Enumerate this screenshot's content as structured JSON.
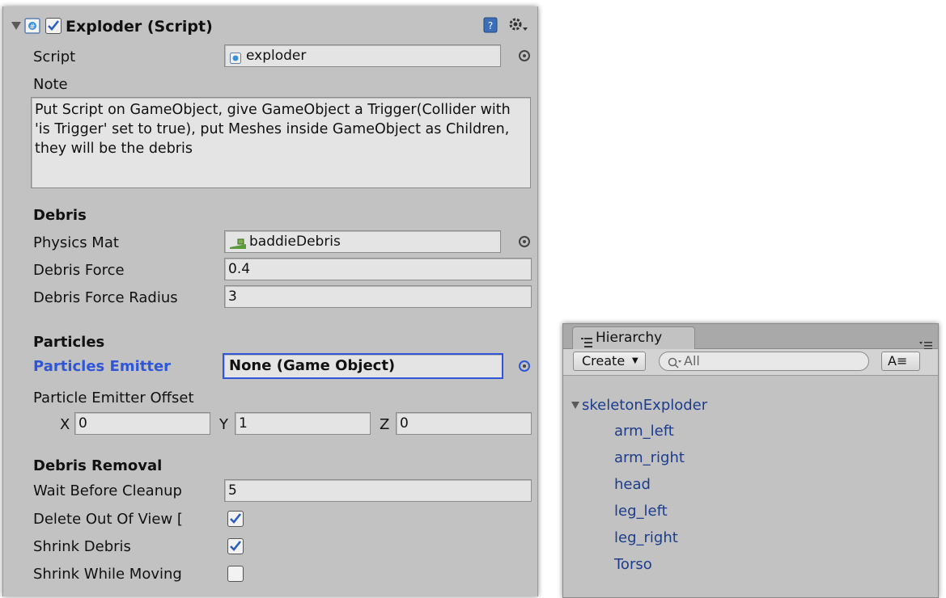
{
  "inspector": {
    "component_title": "Exploder (Script)",
    "component_enabled": true,
    "script_label": "Script",
    "script_value": "exploder",
    "note_label": "Note",
    "note_text": "Put Script on GameObject, give GameObject a Trigger(Collider with 'is Trigger' set to true), put Meshes inside GameObject as Children, they will be the debris",
    "debris_header": "Debris",
    "physics_mat_label": "Physics Mat",
    "physics_mat_value": "baddieDebris",
    "debris_force_label": "Debris Force",
    "debris_force_value": "0.4",
    "debris_force_radius_label": "Debris Force Radius",
    "debris_force_radius_value": "3",
    "particles_header": "Particles",
    "particles_emitter_label": "Particles Emitter",
    "particles_emitter_value": "None (Game Object)",
    "particle_offset_label": "Particle Emitter Offset",
    "offset_x_label": "X",
    "offset_x_value": "0",
    "offset_y_label": "Y",
    "offset_y_value": "1",
    "offset_z_label": "Z",
    "offset_z_value": "0",
    "debris_removal_header": "Debris Removal",
    "wait_cleanup_label": "Wait Before Cleanup",
    "wait_cleanup_value": "5",
    "delete_out_of_view_label": "Delete Out Of View [",
    "delete_out_of_view_checked": true,
    "shrink_debris_label": "Shrink Debris",
    "shrink_debris_checked": true,
    "shrink_while_moving_label": "Shrink While Moving",
    "shrink_while_moving_checked": false
  },
  "hierarchy": {
    "tab_label": "Hierarchy",
    "create_label": "Create",
    "search_placeholder": "All",
    "root": "skeletonExploder",
    "children": [
      "arm_left",
      "arm_right",
      "head",
      "leg_left",
      "leg_right",
      "Torso"
    ]
  },
  "colors": {
    "panel_bg": "#c2c2c2",
    "focus_blue": "#2f56d6",
    "hierarchy_text": "#1c3c8c"
  }
}
